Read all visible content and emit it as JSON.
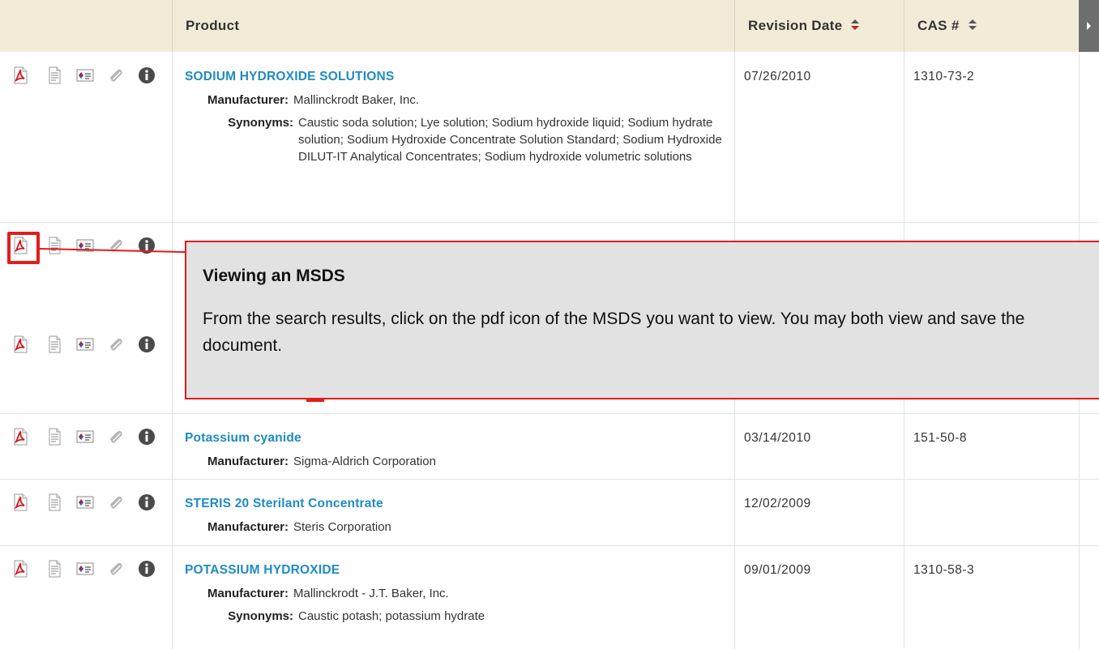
{
  "columns": {
    "product": "Product",
    "revision_date": "Revision Date",
    "cas": "CAS #"
  },
  "labels": {
    "manufacturer": "Manufacturer:",
    "synonyms": "Synonyms:"
  },
  "rows": [
    {
      "name": "SODIUM HYDROXIDE SOLUTIONS",
      "manufacturer": "Mallinckrodt Baker, Inc.",
      "synonyms": "Caustic soda solution; Lye solution; Sodium hydroxide liquid; Sodium hydrate solution; Sodium Hydroxide Concentrate Solution Standard; Sodium Hydroxide DILUT-IT Analytical Concentrates; Sodium hydroxide volumetric solutions",
      "date": "07/26/2010",
      "cas": "1310-73-2"
    },
    {
      "name": "Potassium cyanide",
      "manufacturer": "Sigma-Aldrich Corporation",
      "date": "03/14/2010",
      "cas": "151-50-8"
    },
    {
      "name": "STERIS 20 Sterilant Concentrate",
      "manufacturer": "Steris Corporation",
      "date": "12/02/2009",
      "cas": ""
    },
    {
      "name": "POTASSIUM HYDROXIDE",
      "manufacturer": "Mallinckrodt - J.T. Baker, Inc.",
      "synonyms": "Caustic potash; potassium hydrate",
      "date": "09/01/2009",
      "cas": "1310-58-3"
    }
  ],
  "callout": {
    "title": "Viewing an MSDS",
    "body": "From the search results, click on the pdf icon of the MSDS you want to view.  You may both view and save the document."
  },
  "icons": [
    "pdf-icon",
    "document-icon",
    "nfpa-label-icon",
    "attachment-icon",
    "info-icon"
  ],
  "colors": {
    "header_bg": "#f2ebd8",
    "link": "#1e8bc3",
    "highlight": "#e31c1c",
    "callout_bg": "#e2e2e2"
  }
}
